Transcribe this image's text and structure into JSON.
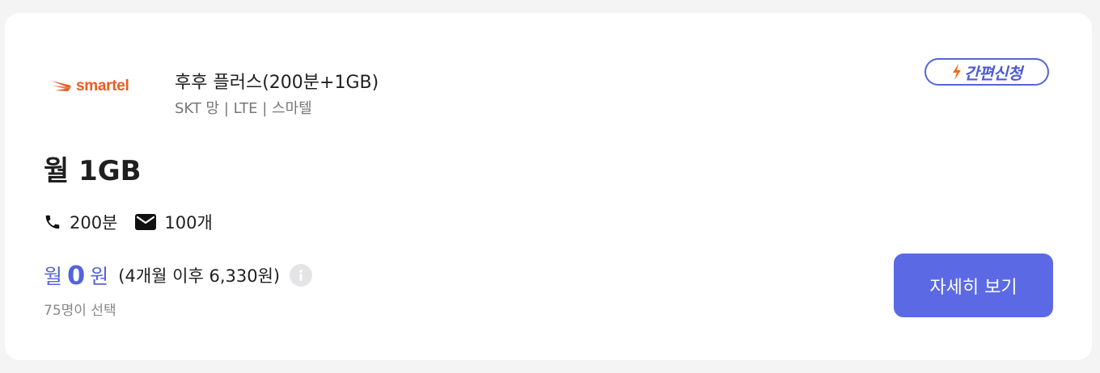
{
  "plan": {
    "logo_text": "smartel",
    "name": "후후 플러스(200분+1GB)",
    "meta": "SKT 망 | LTE | 스마텔",
    "quick_apply_label": "간편신청",
    "data_amount": "월 1GB",
    "features": {
      "call": "200분",
      "sms": "100개"
    },
    "price": {
      "prefix": "월",
      "value": "0",
      "suffix": "원",
      "after_note": "(4개월 이후 6,330원)"
    },
    "selected_count": "75명이 선택",
    "detail_button_label": "자세히 보기"
  },
  "icons": {
    "logo": "smartel-swoosh-icon",
    "quick_apply": "lightning-icon",
    "call": "phone-icon",
    "sms": "envelope-icon",
    "info": "info-icon"
  },
  "colors": {
    "accent": "#5563d8",
    "button": "#5b6ae4",
    "logo": "#ee5a24",
    "lightning": "#f26b1d"
  }
}
